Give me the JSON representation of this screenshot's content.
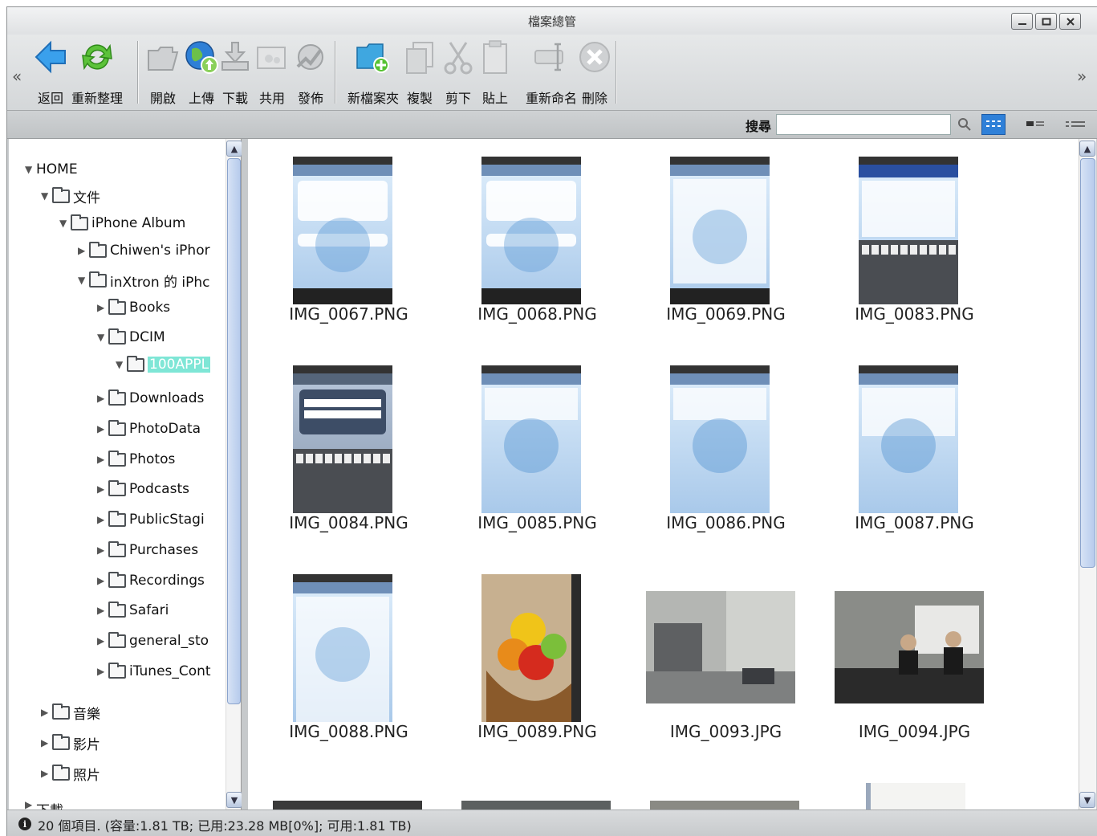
{
  "window": {
    "title": "檔案總管"
  },
  "toolbar": {
    "left_chevron": "«",
    "right_chevron": "»",
    "buttons": [
      {
        "label": "返回",
        "icon": "back-arrow-icon"
      },
      {
        "label": "重新整理",
        "icon": "refresh-icon"
      },
      {
        "label": "開啟",
        "icon": "open-folder-icon"
      },
      {
        "label": "上傳",
        "icon": "upload-globe-icon"
      },
      {
        "label": "下載",
        "icon": "download-icon"
      },
      {
        "label": "共用",
        "icon": "share-icon"
      },
      {
        "label": "發佈",
        "icon": "publish-icon"
      },
      {
        "label": "新檔案夾",
        "icon": "new-folder-icon"
      },
      {
        "label": "複製",
        "icon": "copy-icon"
      },
      {
        "label": "剪下",
        "icon": "cut-icon"
      },
      {
        "label": "貼上",
        "icon": "paste-icon"
      },
      {
        "label": "重新命名",
        "icon": "rename-icon"
      },
      {
        "label": "刪除",
        "icon": "delete-icon"
      }
    ]
  },
  "search": {
    "label": "搜尋",
    "value": ""
  },
  "tree": {
    "nodes": [
      {
        "label": "HOME",
        "expanded": true
      },
      {
        "label": "文件",
        "expanded": true
      },
      {
        "label": "iPhone Album",
        "expanded": true
      },
      {
        "label": "Chiwen's iPhor",
        "expanded": false
      },
      {
        "label": "inXtron 的 iPhc",
        "expanded": true
      },
      {
        "label": "Books",
        "expanded": false
      },
      {
        "label": "DCIM",
        "expanded": true
      },
      {
        "label": "100APPL",
        "expanded": true,
        "selected": true
      },
      {
        "label": "Downloads",
        "expanded": false
      },
      {
        "label": "PhotoData",
        "expanded": false
      },
      {
        "label": "Photos",
        "expanded": false
      },
      {
        "label": "Podcasts",
        "expanded": false
      },
      {
        "label": "PublicStagi",
        "expanded": false
      },
      {
        "label": "Purchases",
        "expanded": false
      },
      {
        "label": "Recordings",
        "expanded": false
      },
      {
        "label": "Safari",
        "expanded": false
      },
      {
        "label": "general_sto",
        "expanded": false
      },
      {
        "label": "iTunes_Cont",
        "expanded": false
      },
      {
        "label": "音樂",
        "expanded": false
      },
      {
        "label": "影片",
        "expanded": false
      },
      {
        "label": "照片",
        "expanded": false
      },
      {
        "label": "下載",
        "expanded": false
      }
    ]
  },
  "files": [
    {
      "name": "IMG_0067.PNG"
    },
    {
      "name": "IMG_0068.PNG"
    },
    {
      "name": "IMG_0069.PNG"
    },
    {
      "name": "IMG_0083.PNG"
    },
    {
      "name": "IMG_0084.PNG"
    },
    {
      "name": "IMG_0085.PNG"
    },
    {
      "name": "IMG_0086.PNG"
    },
    {
      "name": "IMG_0087.PNG"
    },
    {
      "name": "IMG_0088.PNG"
    },
    {
      "name": "IMG_0089.PNG"
    },
    {
      "name": "IMG_0093.JPG"
    },
    {
      "name": "IMG_0094.JPG"
    }
  ],
  "status": {
    "text": "20 個項目. (容量:1.81 TB; 已用:23.28 MB[0%]; 可用:1.81 TB)"
  },
  "colors": {
    "selected_node": "#7fe6d6",
    "toolbar_bg": "#d4d7d9",
    "accent_blue": "#3a8ee6"
  }
}
